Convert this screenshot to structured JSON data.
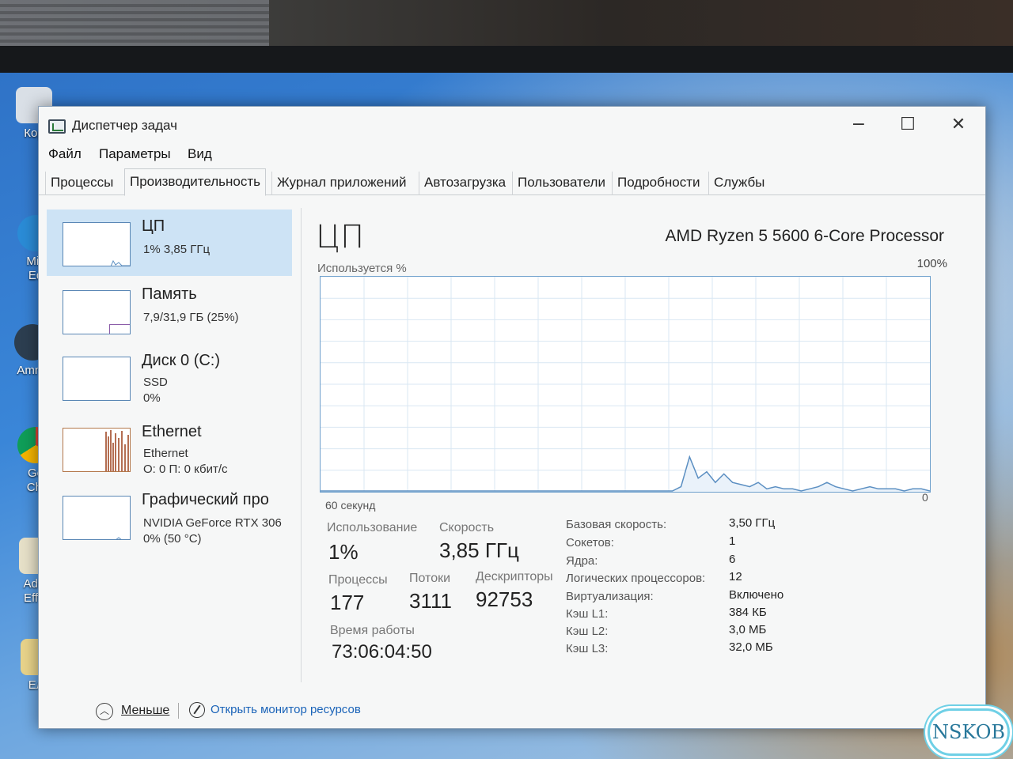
{
  "window": {
    "title": "Диспетчер задач",
    "minimize": "−",
    "maximize": "☐",
    "close": "✕"
  },
  "menu": [
    "Файл",
    "Параметры",
    "Вид"
  ],
  "tabs": [
    {
      "label": "Процессы",
      "active": false
    },
    {
      "label": "Производительность",
      "active": true
    },
    {
      "label": "Журнал приложений",
      "active": false
    },
    {
      "label": "Автозагрузка",
      "active": false
    },
    {
      "label": "Пользователи",
      "active": false
    },
    {
      "label": "Подробности",
      "active": false
    },
    {
      "label": "Службы",
      "active": false
    }
  ],
  "sidebar": [
    {
      "name": "ЦП",
      "sub1": "1% 3,85 ГГц",
      "sub2": "",
      "selected": true
    },
    {
      "name": "Память",
      "sub1": "7,9/31,9 ГБ (25%)",
      "sub2": "",
      "selected": false
    },
    {
      "name": "Диск 0 (C:)",
      "sub1": "SSD",
      "sub2": "0%",
      "selected": false
    },
    {
      "name": "Ethernet",
      "sub1": "Ethernet",
      "sub2": "О: 0 П: 0 кбит/с",
      "selected": false
    },
    {
      "name": "Графический про",
      "sub1": "NVIDIA GeForce RTX 306",
      "sub2": "0% (50 °C)",
      "selected": false
    }
  ],
  "cpu": {
    "title": "ЦП",
    "model": "AMD Ryzen 5 5600 6-Core Processor",
    "graph_label": "Используется %",
    "graph_max": "100%",
    "graph_time": "60 секунд",
    "graph_min": "0",
    "usage_label": "Использование",
    "usage_value": "1%",
    "speed_label": "Скорость",
    "speed_value": "3,85 ГГц",
    "processes_label": "Процессы",
    "processes_value": "177",
    "threads_label": "Потоки",
    "threads_value": "3111",
    "handles_label": "Дескрипторы",
    "handles_value": "92753",
    "uptime_label": "Время работы",
    "uptime_value": "73:06:04:50",
    "details": [
      {
        "label": "Базовая скорость:",
        "value": "3,50 ГГц"
      },
      {
        "label": "Сокетов:",
        "value": "1"
      },
      {
        "label": "Ядра:",
        "value": "6"
      },
      {
        "label": "Логических процессоров:",
        "value": "12"
      },
      {
        "label": "Виртуализация:",
        "value": "Включено"
      },
      {
        "label": "Кэш L1:",
        "value": "384 КБ"
      },
      {
        "label": "Кэш L2:",
        "value": "3,0 МБ"
      },
      {
        "label": "Кэш L3:",
        "value": "32,0 МБ"
      }
    ],
    "history": [
      0,
      0,
      0,
      0,
      0,
      0,
      0,
      0,
      0,
      0,
      0,
      0,
      0,
      0,
      0,
      0,
      0,
      0,
      0,
      0,
      0,
      0,
      0,
      0,
      0,
      0,
      0,
      0,
      0,
      0,
      0,
      0,
      0,
      0,
      0,
      0,
      0,
      0,
      0,
      0,
      0,
      0,
      2,
      16,
      6,
      9,
      4,
      8,
      4,
      3,
      2,
      4,
      1,
      2,
      1,
      1,
      0,
      1,
      2,
      4,
      2,
      1,
      0,
      1,
      2,
      1,
      1,
      1,
      0,
      1,
      1,
      0
    ]
  },
  "footer": {
    "less": "Меньше",
    "monitor": "Открыть монитор ресурсов"
  },
  "desktop_icons": [
    "Кор",
    "Mic\nEd",
    "Amne",
    "Go\nChi",
    "Adob\nEffec",
    "Ель"
  ],
  "watermark": "NSKOB",
  "colors": {
    "accent": "#1a63b8",
    "selected_bg": "#cde3f5",
    "graph_line": "#5b8fc2",
    "graph_border": "#6d9fcc"
  }
}
